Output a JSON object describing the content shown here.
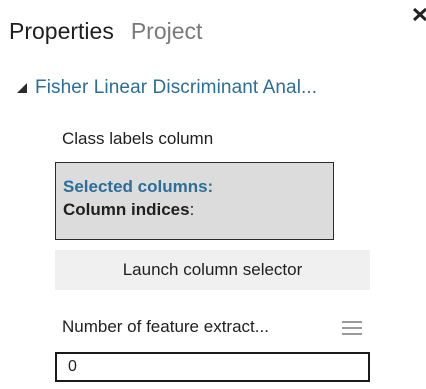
{
  "tabs": [
    {
      "label": "Properties",
      "active": true
    },
    {
      "label": "Project",
      "active": false
    }
  ],
  "close_icon": "close-icon",
  "module": {
    "title": "Fisher Linear Discriminant Anal...",
    "collapse_icon": "triangle-expanded-icon",
    "title_color": "#2a6e99"
  },
  "params": {
    "class_labels": {
      "label": "Class labels column",
      "selected_columns_label": "Selected columns:",
      "column_indices_label": "Column indices",
      "column_indices_suffix": ":",
      "launch_button_label": "Launch column selector"
    },
    "feature_extractors": {
      "label": "Number of feature extract...",
      "value": "0",
      "menu_icon": "hamburger-menu-icon"
    }
  },
  "colors": {
    "accent": "#2a6e99",
    "selection_bg": "#dcdcdc",
    "button_bg": "#f0f0f0",
    "inactive_tab": "#7a7a7a"
  }
}
